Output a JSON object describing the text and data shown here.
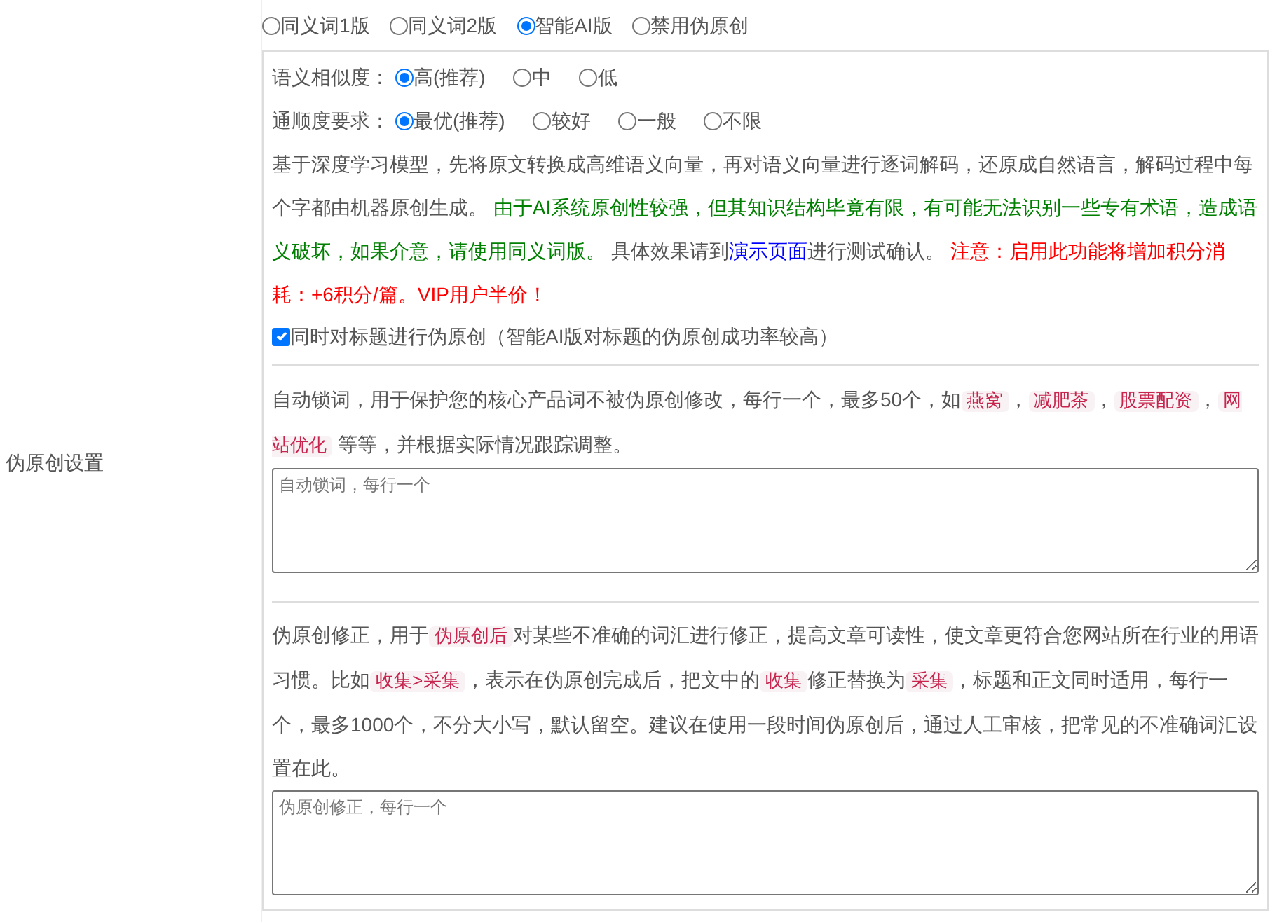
{
  "label": "伪原创设置",
  "modes": [
    {
      "label": "同义词1版",
      "selected": false
    },
    {
      "label": "同义词2版",
      "selected": false
    },
    {
      "label": "智能AI版",
      "selected": true
    },
    {
      "label": "禁用伪原创",
      "selected": false
    }
  ],
  "similarity": {
    "label": "语义相似度：",
    "options": [
      {
        "label": "高(推荐)",
        "selected": true
      },
      {
        "label": "中",
        "selected": false
      },
      {
        "label": "低",
        "selected": false
      }
    ]
  },
  "fluency": {
    "label": "通顺度要求：",
    "options": [
      {
        "label": "最优(推荐)",
        "selected": true
      },
      {
        "label": "较好",
        "selected": false
      },
      {
        "label": "一般",
        "selected": false
      },
      {
        "label": "不限",
        "selected": false
      }
    ]
  },
  "ai_description": [
    {
      "kind": "plain",
      "text": "基于深度学习模型，先将原文转换成高维语义向量，再对语义向量进行逐词解码，还原成自然语言，解码过程中每个字都由机器原创生成。 "
    },
    {
      "kind": "green",
      "text": "由于AI系统原创性较强，但其知识结构毕竟有限，有可能无法识别一些专有术语，造成语义破坏，如果介意，请使用同义词版。"
    },
    {
      "kind": "plain",
      "text": " 具体效果请到"
    },
    {
      "kind": "link",
      "text": "演示页面"
    },
    {
      "kind": "plain",
      "text": "进行测试确认。 "
    },
    {
      "kind": "red",
      "text": "注意：启用此功能将增加积分消耗：+6积分/篇。VIP用户半价！"
    }
  ],
  "title_option": {
    "label": "同时对标题进行伪原创（智能AI版对标题的伪原创成功率较高）",
    "checked": true
  },
  "lock_words": {
    "description": [
      {
        "kind": "plain",
        "text": "自动锁词，用于保护您的核心产品词不被伪原创修改，每行一个，最多50个，如"
      },
      {
        "kind": "code",
        "text": "燕窝"
      },
      {
        "kind": "plain",
        "text": "，"
      },
      {
        "kind": "code",
        "text": "减肥茶"
      },
      {
        "kind": "plain",
        "text": "，"
      },
      {
        "kind": "code",
        "text": "股票配资"
      },
      {
        "kind": "plain",
        "text": "，"
      },
      {
        "kind": "code",
        "text": "网站优化"
      },
      {
        "kind": "plain",
        "text": " 等等，并根据实际情况跟踪调整。"
      }
    ],
    "placeholder": "自动锁词，每行一个"
  },
  "corrections": {
    "description": [
      {
        "kind": "plain",
        "text": "伪原创修正，用于"
      },
      {
        "kind": "code",
        "text": "伪原创后"
      },
      {
        "kind": "plain",
        "text": "对某些不准确的词汇进行修正，提高文章可读性，使文章更符合您网站所在行业的用语习惯。比如"
      },
      {
        "kind": "code",
        "text": "收集>采集"
      },
      {
        "kind": "plain",
        "text": "，表示在伪原创完成后，把文中的"
      },
      {
        "kind": "code",
        "text": "收集"
      },
      {
        "kind": "plain",
        "text": "修正替换为"
      },
      {
        "kind": "code",
        "text": "采集"
      },
      {
        "kind": "plain",
        "text": "，标题和正文同时适用，每行一个，最多1000个，不分大小写，默认留空。建议在使用一段时间伪原创后，通过人工审核，把常见的不准确词汇设置在此。"
      }
    ],
    "placeholder": "伪原创修正，每行一个"
  }
}
